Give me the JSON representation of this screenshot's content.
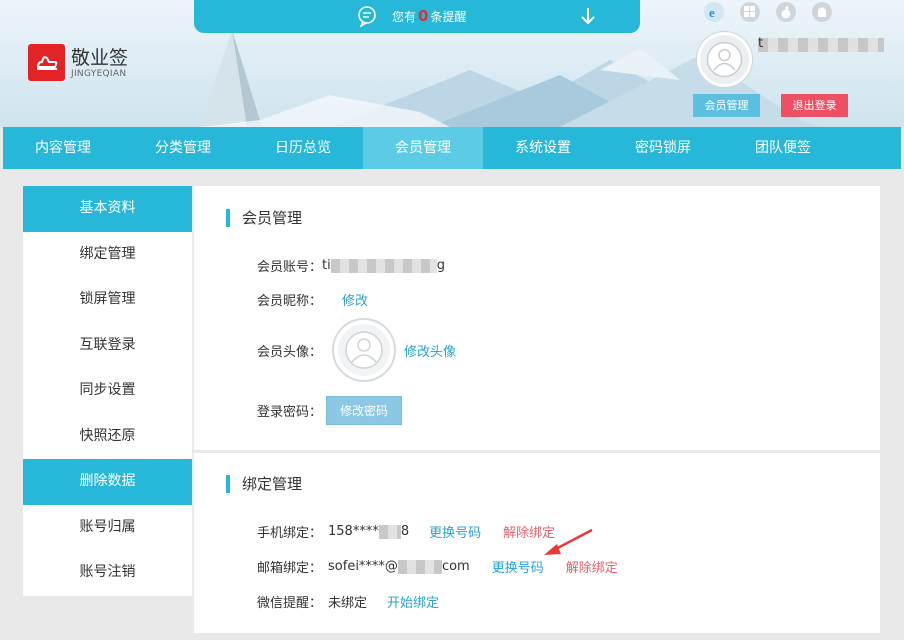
{
  "app": {
    "logo_cn": "敬业签",
    "logo_en": "JINGYEQIAN",
    "brand_color": "#e32426",
    "accent_color": "#27b8d9"
  },
  "reminder": {
    "prefix": "您有",
    "count": "0",
    "suffix": "条提醒"
  },
  "header": {
    "username_start": "t",
    "member_button": "会员管理",
    "logout_button": "退出登录",
    "platform_icons": [
      "ie-icon",
      "windows-icon",
      "apple-icon",
      "android-icon"
    ]
  },
  "nav": {
    "items": [
      "内容管理",
      "分类管理",
      "日历总览",
      "会员管理",
      "系统设置",
      "密码锁屏",
      "团队便签"
    ],
    "active_index": 3
  },
  "sidebar": {
    "items": [
      "基本资料",
      "绑定管理",
      "锁屏管理",
      "互联登录",
      "同步设置",
      "快照还原",
      "删除数据",
      "账号归属",
      "账号注销"
    ],
    "highlighted": [
      0,
      6
    ]
  },
  "member": {
    "title": "会员管理",
    "account_label": "会员账号：",
    "account_start": "ti",
    "account_end": "g",
    "nickname_label": "会员昵称：",
    "nickname_link": "修改",
    "avatar_label": "会员头像：",
    "avatar_link": "修改头像",
    "password_label": "登录密码：",
    "password_button": "修改密码"
  },
  "binding": {
    "title": "绑定管理",
    "phone_label": "手机绑定：",
    "phone_start": "158****",
    "phone_end": "8",
    "phone_change": "更换号码",
    "phone_unbind": "解除绑定",
    "email_label": "邮箱绑定：",
    "email_start": "sofei****@",
    "email_end": "com",
    "email_change": "更换号码",
    "email_unbind": "解除绑定",
    "wechat_label": "微信提醒：",
    "wechat_status": "未绑定",
    "wechat_link": "开始绑定"
  }
}
